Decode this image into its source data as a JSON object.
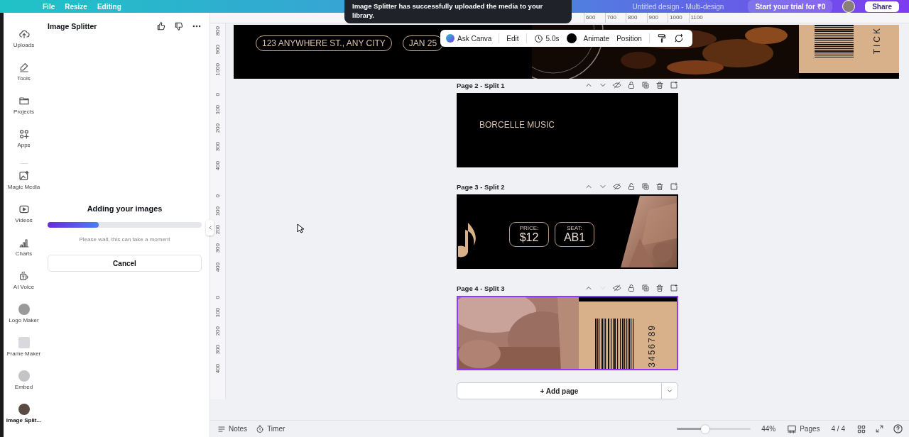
{
  "top_bar": {
    "menu": [
      "File",
      "Resize",
      "Editing"
    ],
    "title": "Untitled design - Multi-design",
    "trial": "Start your trial for ₹0",
    "share": "Share"
  },
  "toast": "Image Splitter has successfully uploaded the media to your library.",
  "rail": [
    {
      "kind": "glyph",
      "label": "Uploads"
    },
    {
      "kind": "glyph",
      "label": "Tools"
    },
    {
      "kind": "glyph",
      "label": "Projects"
    },
    {
      "kind": "glyph",
      "label": "Apps"
    },
    {
      "kind": "glyph",
      "label": "Magic Media"
    },
    {
      "kind": "glyph",
      "label": "Videos"
    },
    {
      "kind": "glyph",
      "label": "Charts"
    },
    {
      "kind": "glyph",
      "label": "AI Voice"
    },
    {
      "kind": "app",
      "label": "Logo Maker"
    },
    {
      "kind": "app",
      "label": "Frame Maker"
    },
    {
      "kind": "app",
      "label": "Embed"
    },
    {
      "kind": "avatar",
      "label": "Image Split..."
    }
  ],
  "panel": {
    "title": "Image Splitter",
    "status": "Adding your images",
    "progress": {
      "level": 0.33
    },
    "hint": "Please wait, this can take a moment",
    "cancel": "Cancel"
  },
  "rulers": {
    "horizontal": [
      "600",
      "700",
      "800",
      "900",
      "1000",
      "1100"
    ],
    "vertical": [
      [
        "800",
        "900",
        "1000"
      ],
      [
        "0",
        "100",
        "200",
        "300",
        "400"
      ],
      [
        "0",
        "100",
        "200",
        "300",
        "400"
      ],
      [
        "0",
        "100",
        "200",
        "300",
        "400"
      ]
    ]
  },
  "toolbar": {
    "ask": "Ask Canva",
    "edit": "Edit",
    "duration": "5.0s",
    "color": "#000000",
    "animate": "Animate",
    "position": "Position"
  },
  "page_1": {
    "address": "123 ANYWHERE ST., ANY CITY",
    "date": "JAN 25",
    "stub": "TICK"
  },
  "pages": [
    {
      "kind": "split1",
      "label": "Page 2 - Split 1",
      "selected": false,
      "down_disabled": false,
      "brand": "BORCELLE MUSIC"
    },
    {
      "kind": "split2",
      "label": "Page 3 - Split 2",
      "selected": false,
      "down_disabled": false,
      "price_label": "PRICE:",
      "price": "$12",
      "seat_label": "SEAT:",
      "seat": "AB1"
    },
    {
      "kind": "split3",
      "label": "Page 4 - Split 3",
      "selected": true,
      "down_disabled": true,
      "serial": "3456789"
    }
  ],
  "add_page": "+ Add page",
  "footer": {
    "notes": "Notes",
    "timer": "Timer",
    "zoom": {
      "level": 0.38
    },
    "zoom_text": "44%",
    "pages": "Pages",
    "page_count": "4 / 4"
  }
}
